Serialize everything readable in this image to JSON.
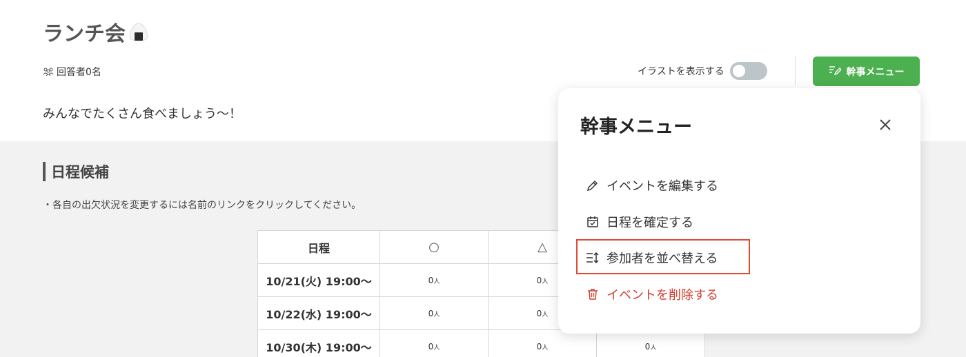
{
  "eventPage": {
    "title": "ランチ会",
    "respondents": "回答者0名",
    "description": "みんなでたくさん食べましょう〜！",
    "illustrationToggleLabel": "イラストを表示する",
    "illustrationToggleOn": false,
    "organizerMenuButton": "幹事メニュー",
    "section": {
      "title": "日程候補",
      "note": "・各自の出欠状況を変更するには名前のリンクをクリックしてください。"
    },
    "table": {
      "headers": [
        "日程",
        "○",
        "△",
        ""
      ],
      "rows": [
        {
          "date": "10/21(火) 19:00〜",
          "counts": [
            "0",
            "0",
            ""
          ]
        },
        {
          "date": "10/22(水) 19:00〜",
          "counts": [
            "0",
            "0",
            ""
          ]
        },
        {
          "date": "10/30(木) 19:00〜",
          "counts": [
            "0",
            "0",
            "0"
          ]
        }
      ],
      "countUnit": "人"
    },
    "menuPanel": {
      "title": "幹事メニュー",
      "closeIcon": "close-icon",
      "menuItems": [
        {
          "label": "イベントを編集する",
          "icon": "pencil-icon",
          "highlighted": false,
          "danger": false
        },
        {
          "label": "日程を確定する",
          "icon": "calendar-check-icon",
          "highlighted": false,
          "danger": false
        },
        {
          "label": "参加者を並べ替える",
          "icon": "sort-icon",
          "highlighted": true,
          "danger": false
        },
        {
          "label": "イベントを削除する",
          "icon": "trash-icon",
          "highlighted": false,
          "danger": true
        }
      ]
    },
    "colors": {
      "accentGreen": "#4caf50",
      "danger": "#d33d2d",
      "highlightBorder": "#e24a33"
    }
  }
}
